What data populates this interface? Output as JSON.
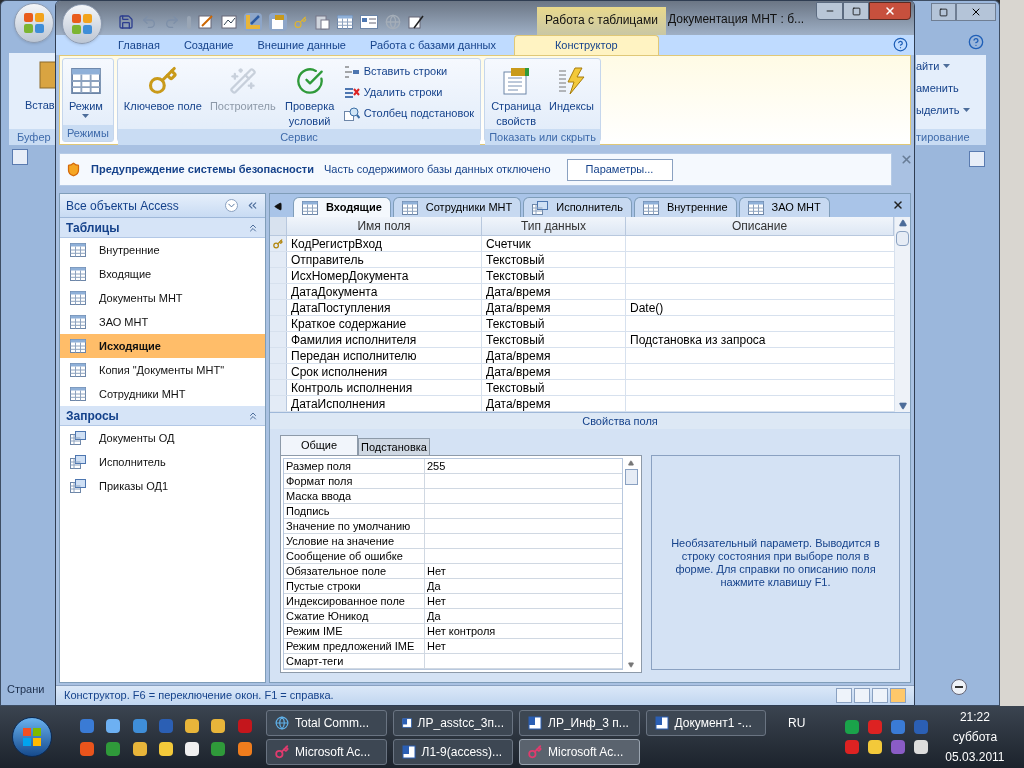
{
  "background_window": {
    "left_command": "Встав",
    "left_group": "Буфер",
    "right_commands": [
      {
        "label": "айти",
        "dropdown": true
      },
      {
        "label": "аменить",
        "dropdown": false
      },
      {
        "label": "ыделить",
        "dropdown": true
      }
    ],
    "right_group": "тирование",
    "status_text": "Страни"
  },
  "window": {
    "title": "Документация МНТ : б...",
    "context_tab": "Работа с таблицами"
  },
  "ribbon": {
    "tabs": [
      {
        "label": "Главная",
        "selected": false
      },
      {
        "label": "Создание",
        "selected": false
      },
      {
        "label": "Внешние данные",
        "selected": false
      },
      {
        "label": "Работа с базами данных",
        "selected": false
      },
      {
        "label": "Конструктор",
        "selected": true
      }
    ],
    "groups": [
      {
        "title": "Режимы",
        "commands": [
          {
            "kind": "view",
            "label": "Режим",
            "dropdown": true,
            "disabled": false
          }
        ]
      },
      {
        "title": "Сервис",
        "commands": [
          {
            "kind": "key",
            "label": "Ключевое поле",
            "dropdown": false,
            "disabled": false
          },
          {
            "kind": "builder",
            "label": "Построитель",
            "dropdown": false,
            "disabled": true
          },
          {
            "kind": "check",
            "label": "Проверка условий",
            "dropdown": false,
            "disabled": false
          },
          {
            "kind": "insert",
            "label": "Вставить строки",
            "disabled": false
          },
          {
            "kind": "delete",
            "label": "Удалить строки",
            "disabled": false
          },
          {
            "kind": "lookup",
            "label": "Столбец  подстановок",
            "disabled": false
          }
        ]
      },
      {
        "title": "Показать или скрыть",
        "commands": [
          {
            "kind": "sheet",
            "label": "Страница свойств",
            "dropdown": false,
            "disabled": false
          },
          {
            "kind": "index",
            "label": "Индексы",
            "dropdown": false,
            "disabled": false
          }
        ]
      }
    ]
  },
  "security_bar": {
    "title": "Предупреждение системы безопасности",
    "message": "Часть содержимого базы данных отключено",
    "button": "Параметры..."
  },
  "navigation": {
    "title": "Все объекты Access",
    "groups": [
      {
        "title": "Таблицы",
        "expanded": true,
        "items": [
          {
            "label": "Внутренние",
            "kind": "table",
            "selected": false
          },
          {
            "label": "Входящие",
            "kind": "table",
            "selected": false
          },
          {
            "label": "Документы МНТ",
            "kind": "table",
            "selected": false
          },
          {
            "label": "ЗАО МНТ",
            "kind": "table",
            "selected": false
          },
          {
            "label": "Исходящие",
            "kind": "table",
            "selected": true
          },
          {
            "label": "Копия \"Документы МНТ\"",
            "kind": "table",
            "selected": false
          },
          {
            "label": "Сотрудники МНТ",
            "kind": "table",
            "selected": false
          }
        ]
      },
      {
        "title": "Запросы",
        "expanded": true,
        "items": [
          {
            "label": "Документы ОД",
            "kind": "query",
            "selected": false
          },
          {
            "label": "Исполнитель",
            "kind": "query",
            "selected": false
          },
          {
            "label": "Приказы ОД1",
            "kind": "query",
            "selected": false
          }
        ]
      }
    ]
  },
  "document_tabs": [
    {
      "label": "Входящие",
      "kind": "table",
      "selected": true
    },
    {
      "label": "Сотрудники МНТ",
      "kind": "table",
      "selected": false
    },
    {
      "label": "Исполнитель",
      "kind": "query",
      "selected": false
    },
    {
      "label": "Внутренние",
      "kind": "table",
      "selected": false
    },
    {
      "label": "ЗАО МНТ",
      "kind": "table",
      "selected": false
    }
  ],
  "design_grid": {
    "columns": [
      "Имя поля",
      "Тип данных",
      "Описание"
    ],
    "rows": [
      {
        "name": "КодРегистрВход",
        "type": "Счетчик",
        "primary_key": true
      },
      {
        "name": "Отправитель",
        "type": "Текстовый",
        "primary_key": false
      },
      {
        "name": "ИсхНомерДокумента",
        "type": "Текстовый",
        "primary_key": false
      },
      {
        "name": "ДатаДокумента",
        "type": "Дата/время",
        "primary_key": false
      },
      {
        "name": "ДатаПоступления",
        "type": "Дата/время",
        "description": "Date()",
        "primary_key": false
      },
      {
        "name": "Краткое содержание",
        "type": "Текстовый",
        "primary_key": false
      },
      {
        "name": "Фамилия исполнителя",
        "type": "Текстовый",
        "description": "Подстановка из запроса",
        "primary_key": false
      },
      {
        "name": "Передан исполнителю",
        "type": "Дата/время",
        "primary_key": false
      },
      {
        "name": "Срок исполнения",
        "type": "Дата/время",
        "primary_key": false
      },
      {
        "name": "Контроль исполнения",
        "type": "Текстовый",
        "primary_key": false
      },
      {
        "name": "ДатаИсполнения",
        "type": "Дата/время",
        "primary_key": false
      }
    ]
  },
  "field_properties": {
    "title": "Свойства поля",
    "tabs": [
      {
        "label": "Общие",
        "selected": true
      },
      {
        "label": "Подстановка",
        "selected": false
      }
    ],
    "rows": [
      {
        "label": "Размер поля",
        "value": "255"
      },
      {
        "label": "Формат поля"
      },
      {
        "label": "Маска ввода"
      },
      {
        "label": "Подпись"
      },
      {
        "label": "Значение по умолчанию"
      },
      {
        "label": "Условие на значение"
      },
      {
        "label": "Сообщение об ошибке"
      },
      {
        "label": "Обязательное поле",
        "value": "Нет"
      },
      {
        "label": "Пустые строки",
        "value": "Да"
      },
      {
        "label": "Индексированное поле",
        "value": "Нет"
      },
      {
        "label": "Сжатие Юникод",
        "value": "Да"
      },
      {
        "label": "Режим IME",
        "value": "Нет контроля"
      },
      {
        "label": "Режим предложений IME",
        "value": "Нет"
      },
      {
        "label": "Смарт-теги"
      }
    ],
    "help": "Необязательный параметр.  Выводится в строку состояния при выборе поля в форме.  Для справки по описанию поля нажмите клавишу F1."
  },
  "status_bar": {
    "text": "Конструктор.  F6 = переключение окон.  F1 = справка."
  },
  "taskbar": {
    "buttons": [
      {
        "label": "Total Comm...",
        "kind": "commander",
        "active": false
      },
      {
        "label": "ЛР_asstcc_3п...",
        "kind": "word",
        "active": false
      },
      {
        "label": "ЛР_Инф_3 п...",
        "kind": "word",
        "active": false
      },
      {
        "label": "Документ1 -...",
        "kind": "word",
        "active": false
      },
      {
        "label": "Microsoft Ac...",
        "kind": "access",
        "active": false
      },
      {
        "label": "Л1-9(access)...",
        "kind": "word",
        "active": false
      },
      {
        "label": "Microsoft Ac...",
        "kind": "access",
        "active": true
      }
    ],
    "language": "RU",
    "time": "21:22",
    "day": "суббота",
    "date": "05.03.2011"
  }
}
